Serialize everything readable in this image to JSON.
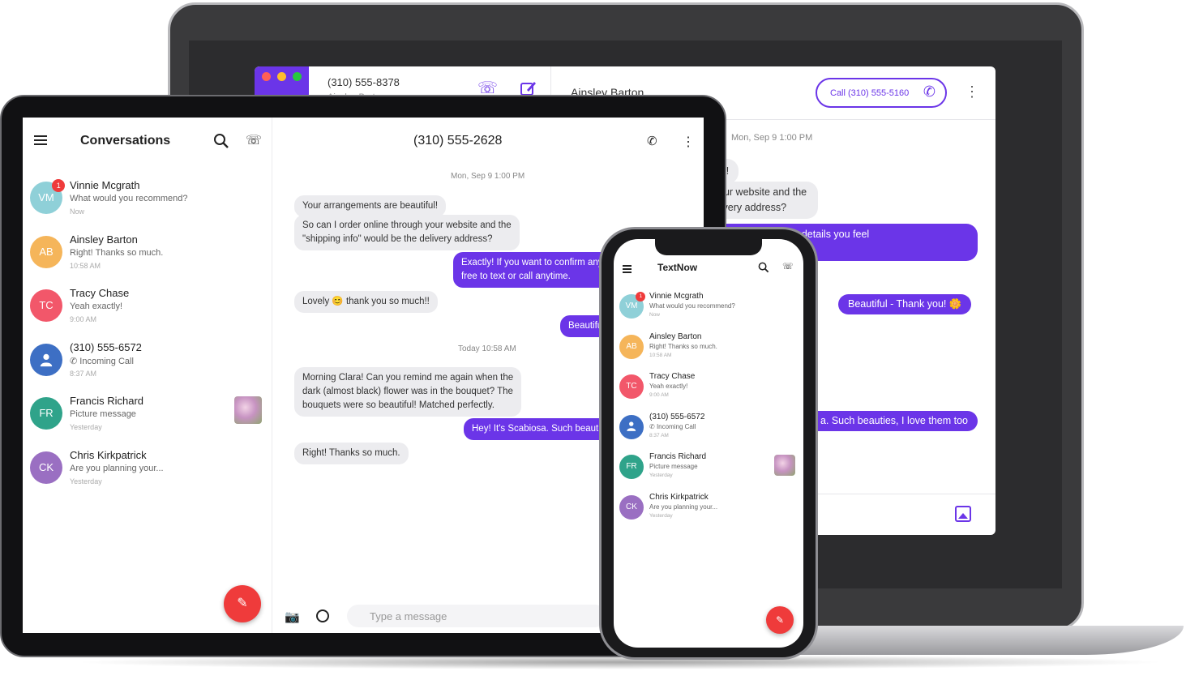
{
  "laptop": {
    "left_number": "(310) 555-8378",
    "left_sub": "Ainsley Barton",
    "contact_name": "Ainsley Barton",
    "call_label": "Call  (310) 555-5160",
    "timestamp": "Mon, Sep 9 1:00 PM",
    "bubbles": [
      {
        "dir": "in",
        "text": "ul!"
      },
      {
        "dir": "in",
        "text": "our website and the\nlivery address?"
      },
      {
        "dir": "out",
        "text": "ant to confirm any details you feel\nanytime."
      },
      {
        "dir": "out",
        "text": "Beautiful - Thank you! 🌼"
      },
      {
        "dir": "out",
        "text": "a. Such beauties, I love them too"
      }
    ]
  },
  "tablet": {
    "title": "Conversations",
    "chat_title": "(310) 555-2628",
    "input_placeholder": "Type a message",
    "stamps": [
      "Mon, Sep 9 1:00 PM",
      "Today 10:58 AM"
    ],
    "messages": [
      {
        "dir": "in",
        "text": "Your arrangements are beautiful!"
      },
      {
        "dir": "in",
        "text": "So can I order online through your website and the\n\"shipping info\" would be the delivery address?"
      },
      {
        "dir": "out",
        "text": "Exactly! If you want to confirm any\nfree to text or call anytime."
      },
      {
        "dir": "in",
        "text": "Lovely 😊 thank you so much!!"
      },
      {
        "dir": "out",
        "text": "Beautiful"
      },
      {
        "dir": "in",
        "text": "Morning Clara! Can you remind me again when the\ndark (almost black) flower was in the bouquet? The\nbouquets were so beautiful! Matched perfectly."
      },
      {
        "dir": "out",
        "text": "Hey! It's Scabiosa. Such beauties"
      },
      {
        "dir": "in",
        "text": "Right! Thanks so much."
      }
    ]
  },
  "phone": {
    "title": "TextNow"
  },
  "conversations": [
    {
      "initials": "VM",
      "name": "Vinnie Mcgrath",
      "preview": "What would you recommend?",
      "time": "Now",
      "badge": "1",
      "color": "#8fd0d8",
      "thumb": false,
      "call": false
    },
    {
      "initials": "AB",
      "name": "Ainsley Barton",
      "preview": "Right! Thanks so much.",
      "time": "10:58 AM",
      "badge": "",
      "color": "#f5b55a",
      "thumb": false,
      "call": false
    },
    {
      "initials": "TC",
      "name": "Tracy Chase",
      "preview": "Yeah exactly!",
      "time": "9:00 AM",
      "badge": "",
      "color": "#f2576a",
      "thumb": false,
      "call": false
    },
    {
      "initials": "",
      "name": "(310) 555-6572",
      "preview": "Incoming Call",
      "time": "8:37 AM",
      "badge": "",
      "color": "#3d6fc4",
      "thumb": false,
      "call": true
    },
    {
      "initials": "FR",
      "name": "Francis Richard",
      "preview": "Picture message",
      "time": "Yesterday",
      "badge": "",
      "color": "#2fa38a",
      "thumb": true,
      "call": false
    },
    {
      "initials": "CK",
      "name": "Chris Kirkpatrick",
      "preview": "Are you planning your...",
      "time": "Yesterday",
      "badge": "",
      "color": "#9a6fc2",
      "thumb": false,
      "call": false
    }
  ],
  "colors": {
    "accent": "#6b35e8",
    "fab": "#ef3b3b"
  }
}
